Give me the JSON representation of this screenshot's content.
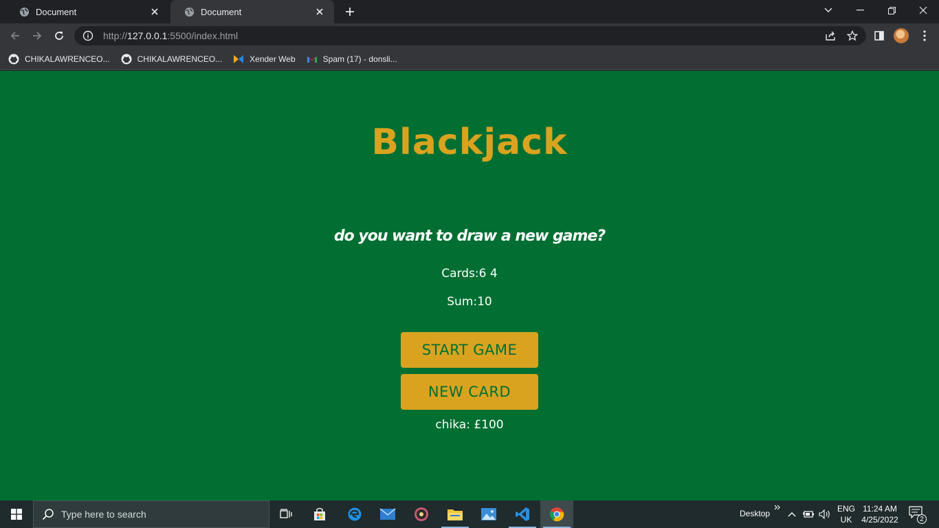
{
  "browser": {
    "tabs": [
      {
        "title": "Document",
        "active": false
      },
      {
        "title": "Document",
        "active": true
      }
    ],
    "url": {
      "scheme": "http://",
      "host": "127.0.0.1",
      "rest": ":5500/index.html"
    },
    "bookmarks": [
      {
        "label": "CHIKALAWRENCEO...",
        "icon": "github-icon"
      },
      {
        "label": "CHIKALAWRENCEO...",
        "icon": "github-icon"
      },
      {
        "label": "Xender Web",
        "icon": "xender-icon"
      },
      {
        "label": "Spam (17) - donsli...",
        "icon": "gmail-icon"
      }
    ]
  },
  "game": {
    "title": "Blackjack",
    "message": "do you want to draw a new game?",
    "cards_text": "Cards:6 4",
    "sum_text": "Sum:10",
    "start_button": "START GAME",
    "new_card_button": "NEW CARD",
    "player_text": "chika: £100",
    "colors": {
      "felt": "#016f32",
      "gold": "#d9a320",
      "text": "#ffffff"
    }
  },
  "taskbar": {
    "search_placeholder": "Type here to search",
    "desktop_label": "Desktop",
    "lang_line1": "ENG",
    "lang_line2": "UK",
    "time": "11:24 AM",
    "date": "4/25/2022",
    "notification_count": "2"
  }
}
